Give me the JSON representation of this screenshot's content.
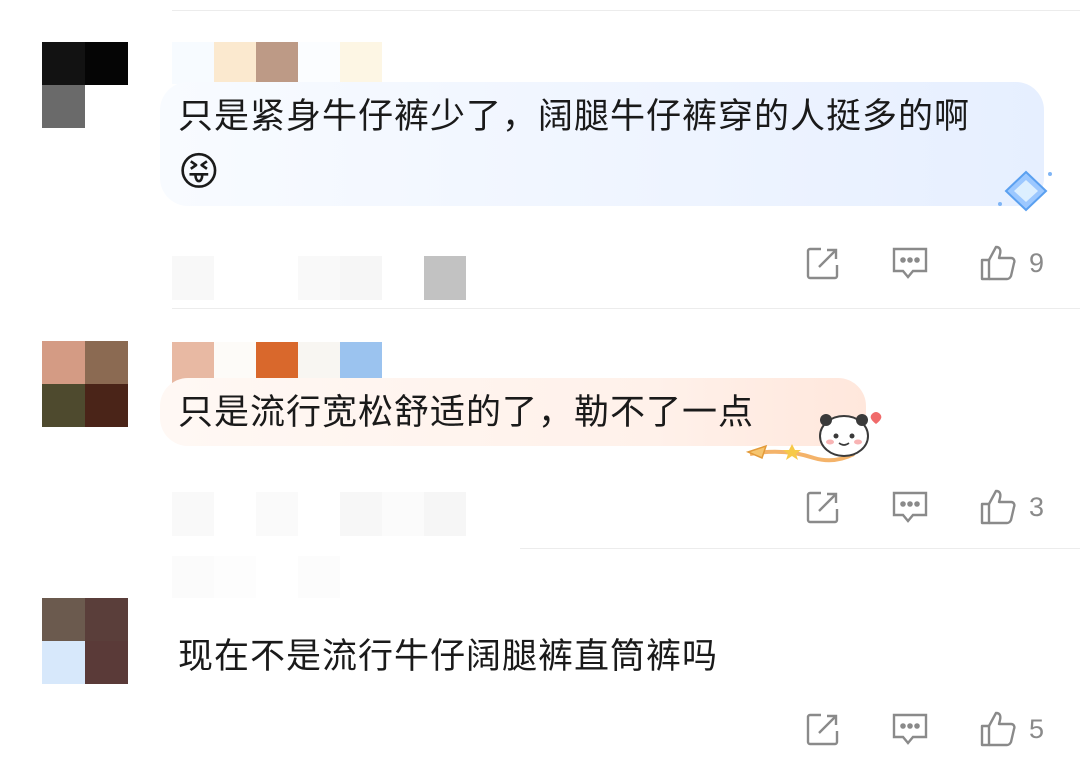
{
  "comments": [
    {
      "text_line1": "只是紧身牛仔裤少了，阔腿牛仔裤穿的人挺多的啊",
      "emoji": "😝",
      "likes": "9"
    },
    {
      "text_line1": "只是流行宽松舒适的了，勒不了一点",
      "likes": "3"
    },
    {
      "text_line1": "现在不是流行牛仔阔腿裤直筒裤吗",
      "likes": "5"
    }
  ],
  "icons": {
    "share": "share-icon",
    "reply": "reply-icon",
    "like": "thumbs-up-icon"
  },
  "colors": {
    "text": "#1a1a1a",
    "icon": "#8a8a8a",
    "bubble1": "#eef4ff",
    "bubble2": "#fff1ea"
  }
}
